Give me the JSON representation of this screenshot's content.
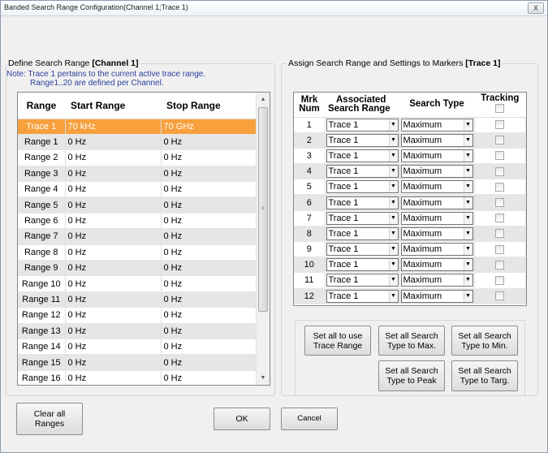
{
  "window": {
    "title": "Banded Search Range Configuration(Channel 1;Trace 1)",
    "close_label": "X"
  },
  "left_group": {
    "legend_prefix": "Define Search Range ",
    "legend_bold": "[Channel 1]",
    "note_line1": "Note: Trace 1 pertains to the current active  trace range.",
    "note_line2": "Range1..20 are defined per Channel.",
    "columns": [
      "Range",
      "Start Range",
      "Stop Range"
    ],
    "rows": [
      {
        "name": "Trace 1",
        "start": "70 kHz",
        "stop": "70 GHz"
      },
      {
        "name": "Range 1",
        "start": "0 Hz",
        "stop": "0 Hz"
      },
      {
        "name": "Range 2",
        "start": "0 Hz",
        "stop": "0 Hz"
      },
      {
        "name": "Range 3",
        "start": "0 Hz",
        "stop": "0 Hz"
      },
      {
        "name": "Range 4",
        "start": "0 Hz",
        "stop": "0 Hz"
      },
      {
        "name": "Range 5",
        "start": "0 Hz",
        "stop": "0 Hz"
      },
      {
        "name": "Range 6",
        "start": "0 Hz",
        "stop": "0 Hz"
      },
      {
        "name": "Range 7",
        "start": "0 Hz",
        "stop": "0 Hz"
      },
      {
        "name": "Range 8",
        "start": "0 Hz",
        "stop": "0 Hz"
      },
      {
        "name": "Range 9",
        "start": "0 Hz",
        "stop": "0 Hz"
      },
      {
        "name": "Range 10",
        "start": "0 Hz",
        "stop": "0 Hz"
      },
      {
        "name": "Range 11",
        "start": "0 Hz",
        "stop": "0 Hz"
      },
      {
        "name": "Range 12",
        "start": "0 Hz",
        "stop": "0 Hz"
      },
      {
        "name": "Range 13",
        "start": "0 Hz",
        "stop": "0 Hz"
      },
      {
        "name": "Range 14",
        "start": "0 Hz",
        "stop": "0 Hz"
      },
      {
        "name": "Range 15",
        "start": "0 Hz",
        "stop": "0 Hz"
      },
      {
        "name": "Range 16",
        "start": "0 Hz",
        "stop": "0 Hz"
      }
    ],
    "selected_row": 0,
    "selected_color": "#f7a03d",
    "scroll_up_icon": "arrow-up-icon",
    "scroll_down_icon": "arrow-down-icon"
  },
  "right_group": {
    "legend_prefix": "Assign Search Range and Settings to Markers ",
    "legend_bold": "[Trace 1]",
    "columns": {
      "mrk_line1": "Mrk",
      "mrk_line2": "Num",
      "assoc_line1": "Associated",
      "assoc_line2": "Search Range",
      "type": "Search Type",
      "tracking": "Tracking"
    },
    "markers": [
      {
        "num": "1",
        "range": "Trace 1",
        "type": "Maximum",
        "tracking": false
      },
      {
        "num": "2",
        "range": "Trace 1",
        "type": "Maximum",
        "tracking": false
      },
      {
        "num": "3",
        "range": "Trace 1",
        "type": "Maximum",
        "tracking": false
      },
      {
        "num": "4",
        "range": "Trace 1",
        "type": "Maximum",
        "tracking": false
      },
      {
        "num": "5",
        "range": "Trace 1",
        "type": "Maximum",
        "tracking": false
      },
      {
        "num": "6",
        "range": "Trace 1",
        "type": "Maximum",
        "tracking": false
      },
      {
        "num": "7",
        "range": "Trace 1",
        "type": "Maximum",
        "tracking": false
      },
      {
        "num": "8",
        "range": "Trace 1",
        "type": "Maximum",
        "tracking": false
      },
      {
        "num": "9",
        "range": "Trace 1",
        "type": "Maximum",
        "tracking": false
      },
      {
        "num": "10",
        "range": "Trace 1",
        "type": "Maximum",
        "tracking": false
      },
      {
        "num": "11",
        "range": "Trace 1",
        "type": "Maximum",
        "tracking": false
      },
      {
        "num": "12",
        "range": "Trace 1",
        "type": "Maximum",
        "tracking": false
      }
    ],
    "buttons": {
      "use_trace_line1": "Set all to use",
      "use_trace_line2": "Trace Range",
      "type_max_line1": "Set all Search",
      "type_max_line2": "Type to Max.",
      "type_min_line1": "Set all Search",
      "type_min_line2": "Type to Min.",
      "type_peak_line1": "Set all Search",
      "type_peak_line2": "Type to Peak",
      "type_targ_line1": "Set all Search",
      "type_targ_line2": "Type to Targ."
    }
  },
  "footer": {
    "clear_line1": "Clear all",
    "clear_line2": "Ranges",
    "ok": "OK",
    "cancel": "Cancel"
  }
}
